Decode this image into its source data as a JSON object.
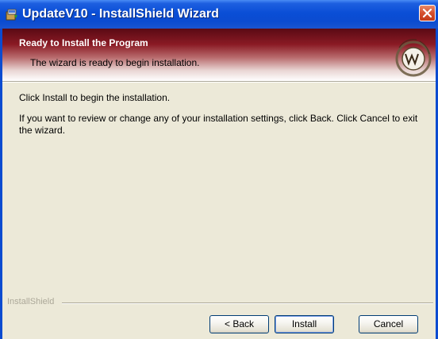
{
  "window": {
    "title": "UpdateV10 - InstallShield Wizard"
  },
  "banner": {
    "title": "Ready to Install the Program",
    "subtitle": "The wizard is ready to begin installation.",
    "logo_icon": "trimble-logo"
  },
  "body": {
    "line1": "Click Install to begin the installation.",
    "line2": "If you want to review or change any of your installation settings, click Back. Click Cancel to exit the wizard."
  },
  "footer": {
    "brand": "InstallShield"
  },
  "buttons": {
    "back": "< Back",
    "install": "Install",
    "cancel": "Cancel"
  },
  "colors": {
    "titlebar": "#0b4bd0",
    "banner_dark": "#5a0a14",
    "close": "#d5502e",
    "face": "#ece9d8"
  }
}
